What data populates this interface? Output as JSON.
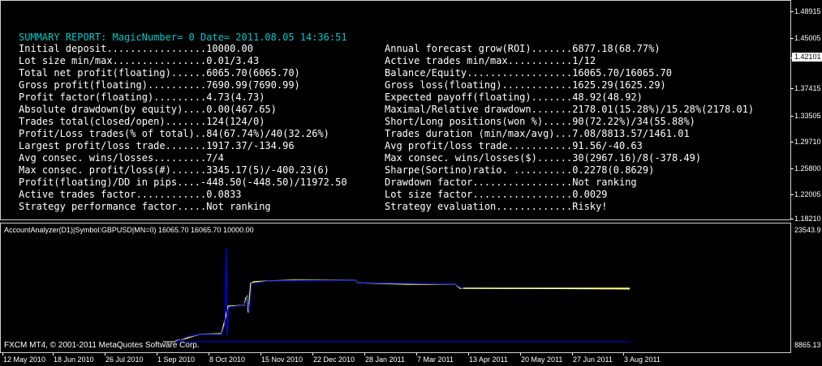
{
  "report": {
    "title": "SUMMARY REPORT: MagicNumber= 0 Date= 2011.08.05 14:36:51",
    "left_lines": [
      "Initial deposit.................10000.00",
      "Lot size min/max................0.01/3.43",
      "Total net profit(floating)......6065.70(6065.70)",
      "Gross profit(floating)..........7690.99(7690.99)",
      "Profit factor(floating).........4.73(4.73)",
      "Absolute drawdown(by equity)....0.00(467.65)",
      "Trades total(closed/open).......124(124/0)",
      "Profit/Loss trades(% of total)..84(67.74%)/40(32.26%)",
      "Largest profit/loss trade.......1917.37/-134.96",
      "Avg consec. wins/losses.........7/4",
      "Max consec. profit/loss(#)......3345.17(5)/-400.23(6)",
      "Profit(floating)/DD in pips....-448.50(-448.50)/11972.50",
      "Active trades factor............0.0833",
      "Strategy performance factor.....Not ranking"
    ],
    "right_lines": [
      "Annual forecast grow(ROI).......6877.18(68.77%)",
      "Active trades min/max...........1/12",
      "Balance/Equity..................16065.70/16065.70",
      "Gross loss(floating)............1625.29(1625.29)",
      "Expected payoff(floating).......48.92(48.92)",
      "Maximal/Relative drawdown.......2178.01(15.28%)/15.28%(2178.01)",
      "Short/Long positions(won %).....90(72.22%)/34(55.88%)",
      "Trades duration (min/max/avg)...7.08/8813.57/1461.01",
      "Avg profit/loss trade...........91.56/-40.63",
      "Max consec. wins/losses($)......30(2967.16)/8(-378.49)",
      "Sharpe(Sortino)ratio. ..........0.2278(0.8629)",
      "Drawdown factor.................Not ranking",
      "Lot size factor.................0.0029",
      "Strategy evaluation.............Risky!"
    ]
  },
  "price_scale": {
    "labels": [
      "1.48915",
      "1.45005",
      "1.42101",
      "1.37415",
      "1.33505",
      "1.29710",
      "1.25800",
      "1.22005",
      "1.18210"
    ],
    "current": "1.42101"
  },
  "indicator": {
    "caption": "AccountAnalyzer(D1)|Symbol:GBPUSD|MN=0) 16065.70 16065.70 10000.00",
    "scale_max": "23543.9",
    "scale_min": "8865.13",
    "copyright": "FXCM MT4, © 2001-2011 MetaQuotes Software Corp.",
    "colors": {
      "balance": "#0000ff",
      "equity": "#ffff00",
      "flat": "#ffffff"
    }
  },
  "time_scale": {
    "labels": [
      "12 May 2010",
      "18 Jun 2010",
      "26 Jul 2010",
      "1 Sep 2010",
      "8 Oct 2010",
      "15 Nov 2010",
      "22 Dec 2010",
      "28 Jan 2011",
      "7 Mar 2011",
      "13 Apr 2011",
      "20 May 2011",
      "27 Jun 2011",
      "3 Aug 2011"
    ]
  }
}
